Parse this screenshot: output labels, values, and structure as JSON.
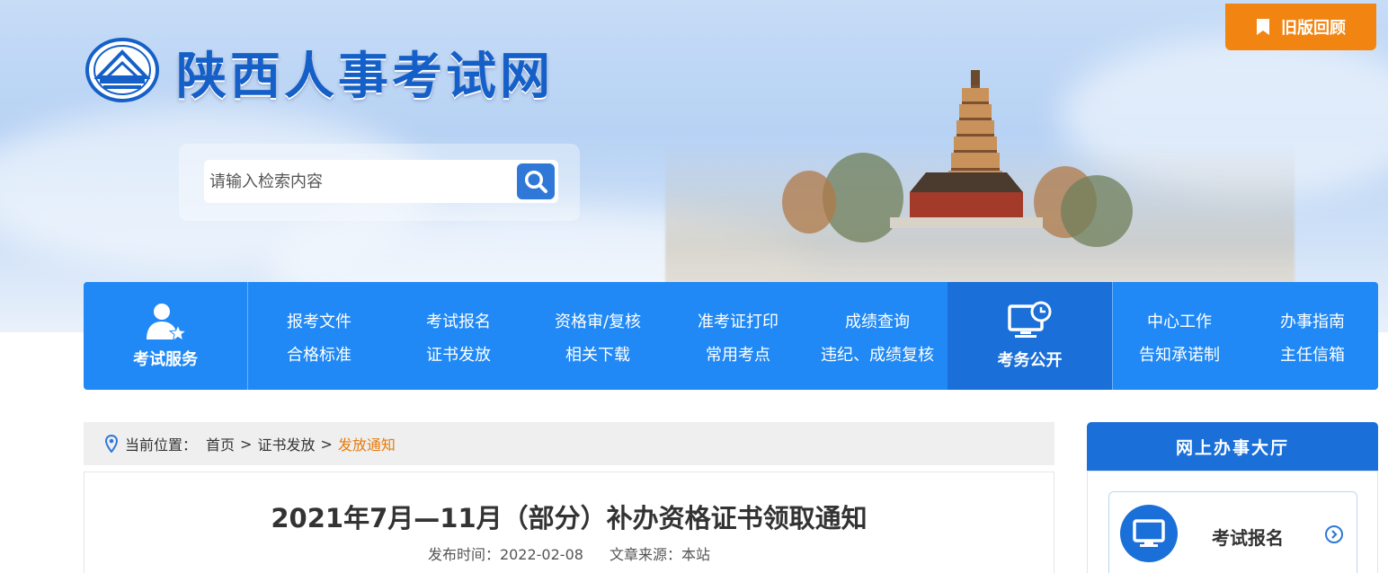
{
  "header": {
    "site_title": "陕西人事考试网",
    "old_version_label": "旧版回顾",
    "search_placeholder": "请输入检索内容"
  },
  "nav": {
    "exam_service_label": "考试服务",
    "exam_links_row1": [
      "报考文件",
      "考试报名",
      "资格审/复核",
      "准考证打印",
      "成绩查询"
    ],
    "exam_links_row2": [
      "合格标准",
      "证书发放",
      "相关下载",
      "常用考点",
      "违纪、成绩复核"
    ],
    "public_label": "考务公开",
    "public_links_row1": [
      "中心工作",
      "办事指南"
    ],
    "public_links_row2": [
      "告知承诺制",
      "主任信箱"
    ]
  },
  "breadcrumb": {
    "prefix": "当前位置：",
    "home": "首页",
    "section": "证书发放",
    "current": "发放通知",
    "separator": ">"
  },
  "article": {
    "title": "2021年7月—11月（部分）补办资格证书领取通知",
    "publish_label": "发布时间：2022-02-08",
    "source_label": "文章来源：本站"
  },
  "sidebar": {
    "title": "网上办事大厅",
    "cards": [
      {
        "label": "考试报名",
        "icon": "monitor-icon"
      }
    ]
  },
  "colors": {
    "brand_blue": "#2089f5",
    "dark_blue": "#1a6fd8",
    "orange": "#f28512",
    "breadcrumb_current": "#e67b0e"
  }
}
